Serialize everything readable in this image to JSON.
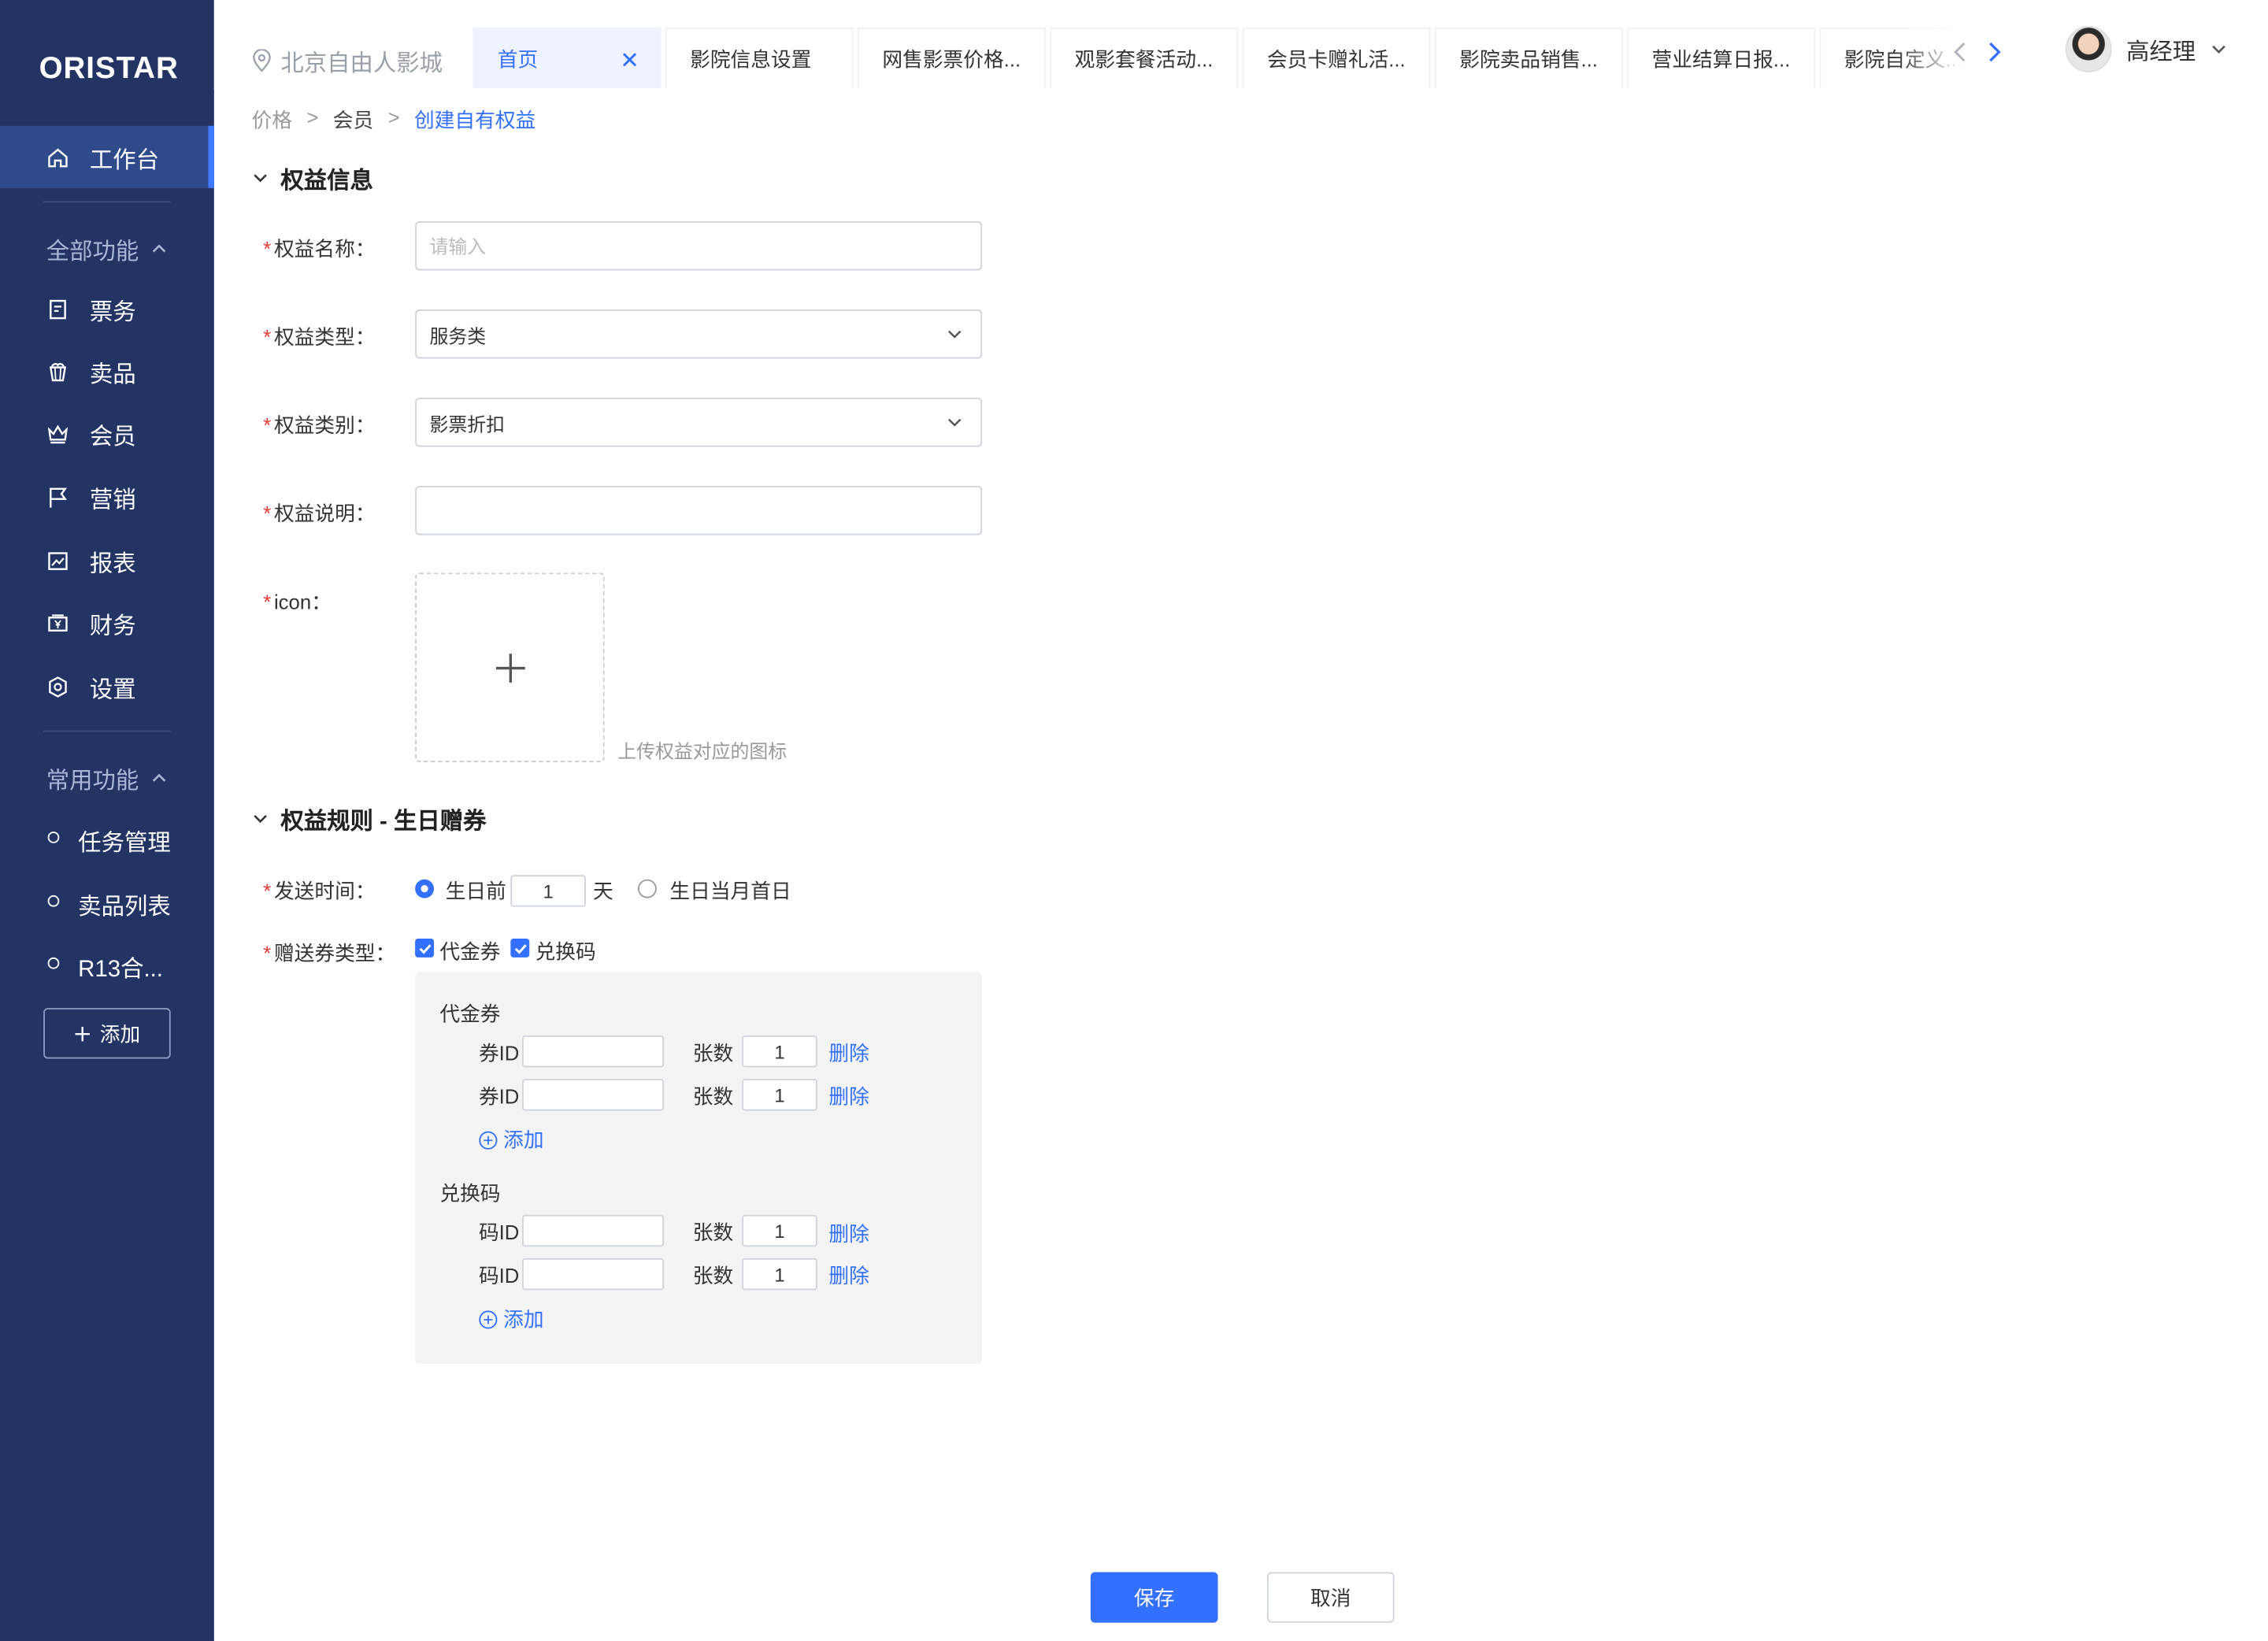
{
  "brand": {
    "logo": "ORISTAR"
  },
  "sidebar": {
    "workbench": "工作台",
    "all_features": "全部功能",
    "items": [
      {
        "label": "票务",
        "icon": "ticket-icon"
      },
      {
        "label": "卖品",
        "icon": "popcorn-icon"
      },
      {
        "label": "会员",
        "icon": "crown-icon"
      },
      {
        "label": "营销",
        "icon": "flag-icon"
      },
      {
        "label": "报表",
        "icon": "chart-icon"
      },
      {
        "label": "财务",
        "icon": "finance-icon"
      },
      {
        "label": "设置",
        "icon": "gear-icon"
      }
    ],
    "common_features": "常用功能",
    "favorites": [
      "任务管理",
      "卖品列表",
      "R13合..."
    ],
    "add_label": "添加"
  },
  "topbar": {
    "location": "北京自由人影城",
    "tabs": [
      "首页",
      "影院信息设置",
      "网售影票价格...",
      "观影套餐活动...",
      "会员卡赠礼活...",
      "影院卖品销售...",
      "营业结算日报...",
      "影院自定义..."
    ],
    "user": "高经理"
  },
  "breadcrumb": [
    "价格",
    "会员",
    "创建自有权益"
  ],
  "section_info": {
    "title": "权益信息",
    "name_label": "权益名称：",
    "name_placeholder": "请输入",
    "type_label": "权益类型：",
    "type_value": "服务类",
    "category_label": "权益类别：",
    "category_value": "影票折扣",
    "desc_label": "权益说明：",
    "desc_value": "",
    "icon_label": "icon：",
    "upload_hint": "上传权益对应的图标"
  },
  "section_rules": {
    "title": "权益规则 - 生日赠券",
    "send_time_label": "发送时间：",
    "before_birthday": "生日前",
    "days_value": "1",
    "days_unit": "天",
    "first_day_of_month": "生日当月首日",
    "voucher_type_label": "赠送券类型：",
    "voucher_option": "代金券",
    "code_option": "兑换码",
    "voucher_panel": {
      "title": "代金券",
      "id_label": "券ID",
      "qty_label": "张数",
      "rows": [
        {
          "id": "",
          "qty": "1"
        },
        {
          "id": "",
          "qty": "1"
        }
      ],
      "delete": "删除",
      "add": "添加"
    },
    "code_panel": {
      "title": "兑换码",
      "id_label": "码ID",
      "qty_label": "张数",
      "rows": [
        {
          "id": "",
          "qty": "1"
        },
        {
          "id": "",
          "qty": "1"
        }
      ],
      "delete": "删除",
      "add": "添加"
    }
  },
  "actions": {
    "save": "保存",
    "cancel": "取消"
  },
  "colors": {
    "sidebar_bg": "#233464",
    "accent": "#3370ff",
    "required": "#e53935"
  }
}
